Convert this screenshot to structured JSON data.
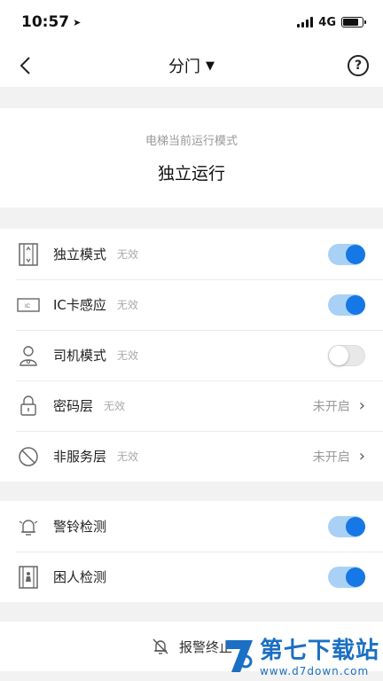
{
  "status_bar": {
    "time": "10:57",
    "network": "4G"
  },
  "nav": {
    "title": "分门",
    "caret": "▼",
    "help": "?"
  },
  "mode": {
    "label": "电梯当前运行模式",
    "value": "独立运行"
  },
  "group1": [
    {
      "title": "独立模式",
      "sub": "无效",
      "toggle": "on",
      "icon": "elevator-icon"
    },
    {
      "title": "IC卡感应",
      "sub": "无效",
      "toggle": "on",
      "icon": "ic-card-icon"
    },
    {
      "title": "司机模式",
      "sub": "无效",
      "toggle": "off",
      "icon": "driver-icon"
    },
    {
      "title": "密码层",
      "sub": "无效",
      "state": "未开启",
      "icon": "lock-icon"
    },
    {
      "title": "非服务层",
      "sub": "无效",
      "state": "未开启",
      "icon": "prohibited-icon"
    }
  ],
  "group2": [
    {
      "title": "警铃检测",
      "toggle": "on",
      "icon": "alarm-bell-icon"
    },
    {
      "title": "困人检测",
      "toggle": "on",
      "icon": "trapped-person-icon"
    }
  ],
  "alarm_end": {
    "label": "报警终止"
  },
  "watermark": {
    "title": "第七下载站",
    "url": "www.d7down.com"
  },
  "colors": {
    "accent": "#1677e6",
    "toggle_track_on": "#a9d1f5",
    "background": "#f2f2f2"
  }
}
